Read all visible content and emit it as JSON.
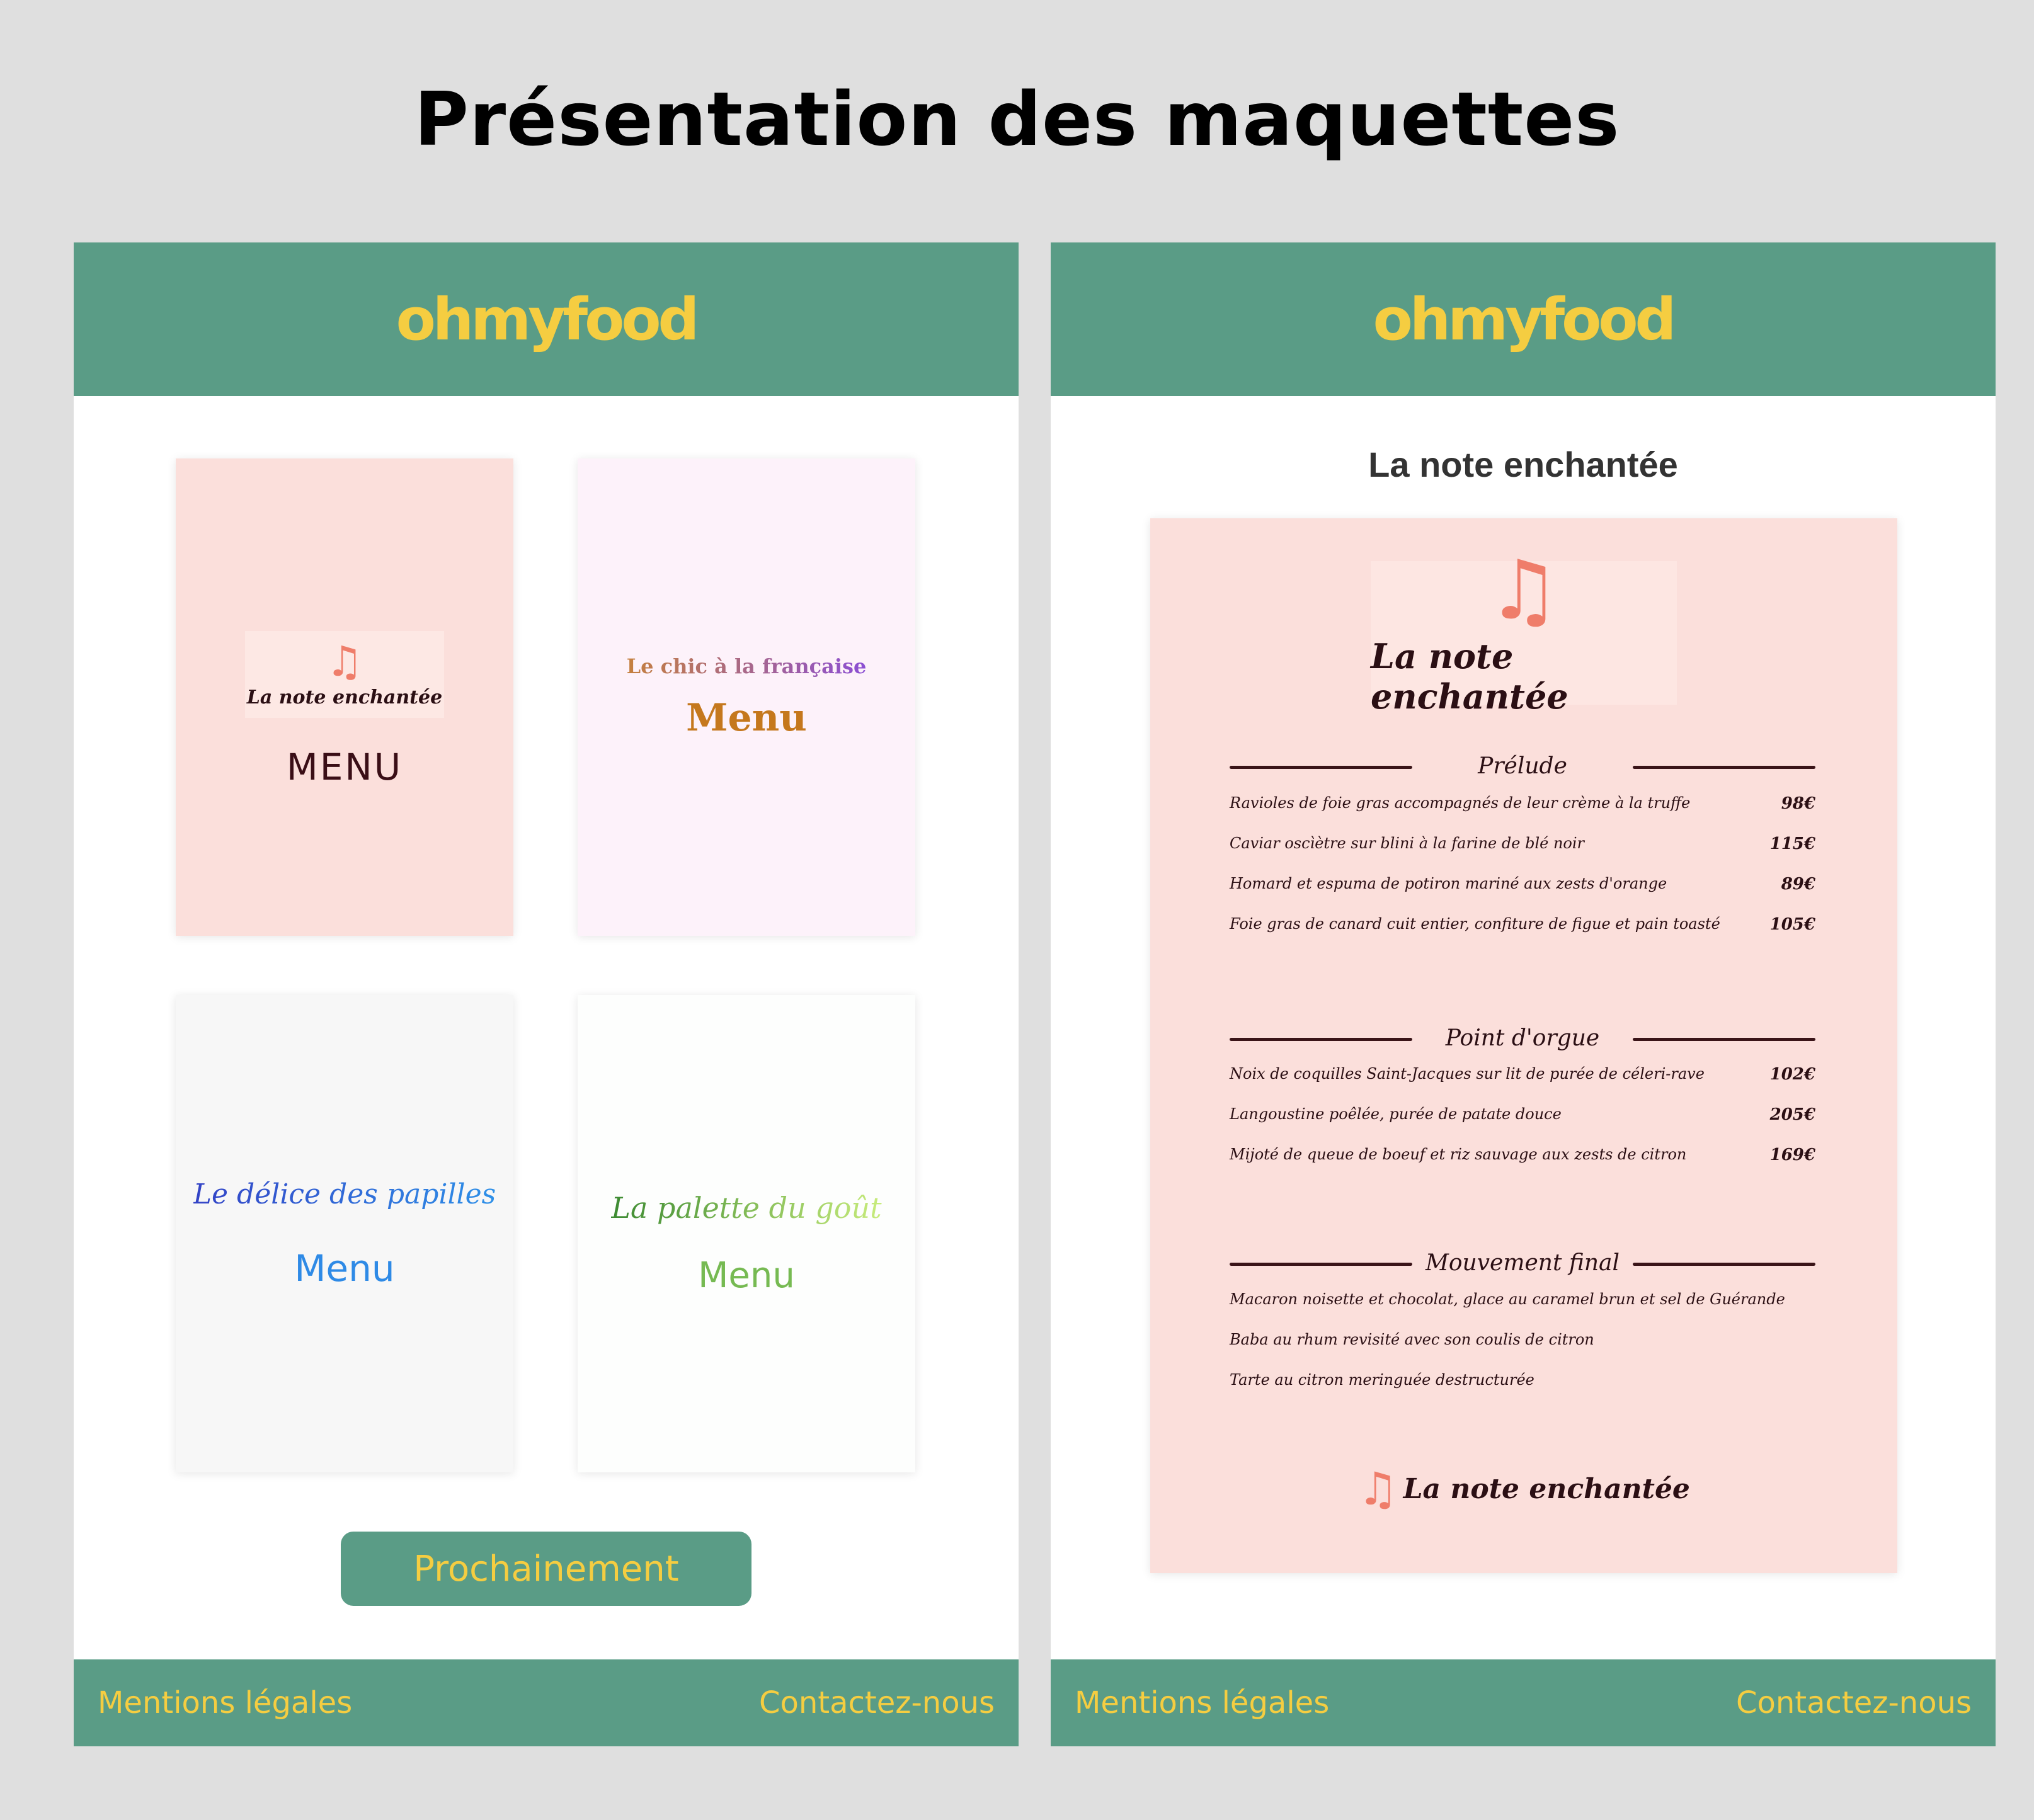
{
  "page": {
    "title": "Présentation des maquettes"
  },
  "brand": {
    "logo": "ohmyfood"
  },
  "footer": {
    "legal": "Mentions légales",
    "contact": "Contactez-nous"
  },
  "colors": {
    "header_bg": "#5a9c86",
    "accent_yellow": "#f5cd41",
    "page_bg": "#dfdfdf"
  },
  "home": {
    "cards": [
      {
        "name": "La note enchantée",
        "menu": "MENU",
        "icon": "music-note-icon"
      },
      {
        "name": "Le chic à la française",
        "menu": "Menu"
      },
      {
        "name": "Le délice des papilles",
        "menu": "Menu"
      },
      {
        "name": "La palette du goût",
        "menu": "Menu"
      }
    ],
    "soon_button": "Prochainement"
  },
  "restaurant": {
    "title": "La note enchantée",
    "logo_name": "La note enchantée",
    "note_icon": "♫",
    "sections": [
      {
        "label": "Prélude",
        "dishes": [
          {
            "name": "Ravioles de foie gras accompagnés de leur crème à la truffe",
            "price": "98€"
          },
          {
            "name": "Caviar oscìètre sur blini à la farine de blé noir",
            "price": "115€"
          },
          {
            "name": "Homard et espuma de potiron mariné aux zests d'orange",
            "price": "89€"
          },
          {
            "name": "Foie gras de canard cuit entier, confiture de figue et pain toasté",
            "price": "105€"
          }
        ]
      },
      {
        "label": "Point d'orgue",
        "dishes": [
          {
            "name": "Noix de coquilles Saint-Jacques sur lit de purée de céleri-rave",
            "price": "102€"
          },
          {
            "name": "Langoustine poêlée, purée de patate douce",
            "price": "205€"
          },
          {
            "name": "Mijoté de queue de boeuf et riz sauvage aux zests de citron",
            "price": "169€"
          }
        ]
      },
      {
        "label": "Mouvement final",
        "dishes": [
          {
            "name": "Macaron noisette et chocolat, glace au caramel brun et sel de Guérande",
            "price": ""
          },
          {
            "name": "Baba au rhum revisité avec son coulis de citron",
            "price": ""
          },
          {
            "name": "Tarte au citron meringuée destructurée",
            "price": ""
          }
        ]
      }
    ],
    "footer_name": "La note enchantée"
  }
}
